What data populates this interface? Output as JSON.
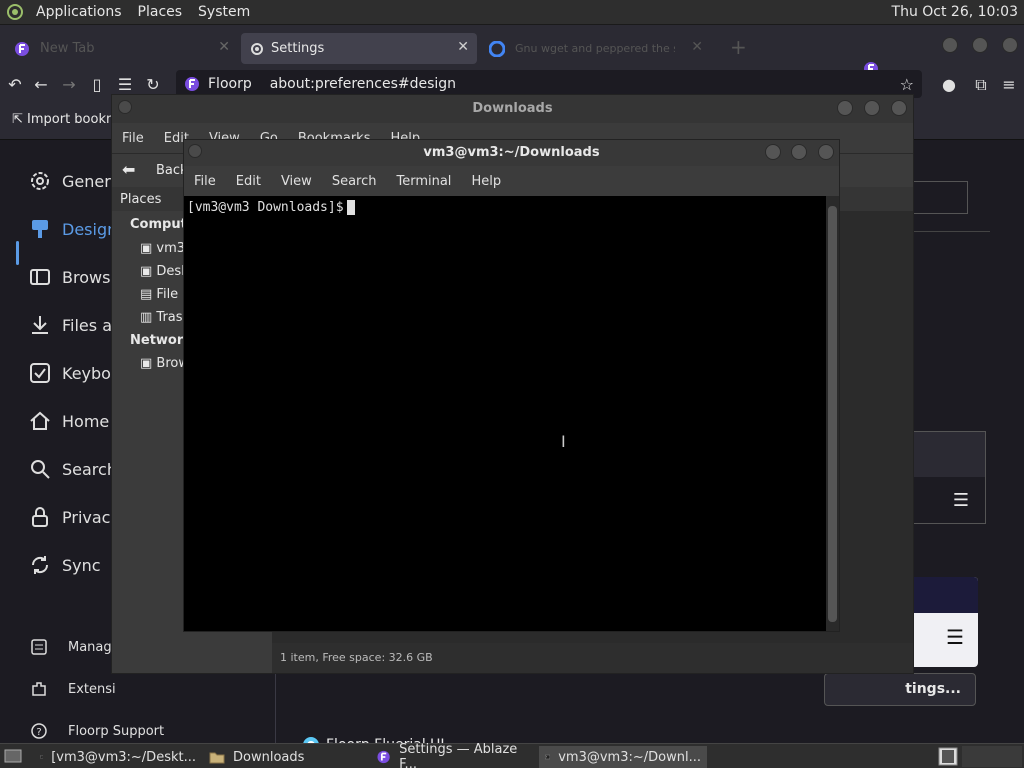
{
  "top_panel": {
    "menus": [
      "Applications",
      "Places",
      "System"
    ],
    "clock": "Thu Oct 26, 10:03"
  },
  "browser": {
    "tabs": [
      {
        "label": "New Tab",
        "active": false
      },
      {
        "label": "Settings",
        "active": true
      },
      {
        "label": "Gnu wget and peppered the same",
        "active": false
      }
    ],
    "toolbar": {
      "identity": "Floorp",
      "url": "about:preferences#design"
    },
    "bookmarks": {
      "import_label": "Import bookm"
    }
  },
  "settings": {
    "sidebar": [
      {
        "label": "General",
        "icon": "gear-icon"
      },
      {
        "label": "Design",
        "icon": "brush-icon",
        "selected": true
      },
      {
        "label": "Browser",
        "icon": "browser-icon"
      },
      {
        "label": "Files and",
        "icon": "download-icon"
      },
      {
        "label": "Keyboard",
        "icon": "keyboard-icon"
      },
      {
        "label": "Home",
        "icon": "home-icon"
      },
      {
        "label": "Search",
        "icon": "search-icon"
      },
      {
        "label": "Privacy",
        "icon": "lock-icon"
      },
      {
        "label": "Sync",
        "icon": "sync-icon"
      }
    ],
    "sidebar_small": [
      {
        "label": "Manage",
        "icon": "manage-icon"
      },
      {
        "label": "Extensi",
        "icon": "extension-icon"
      },
      {
        "label": "Floorp Support",
        "icon": "help-icon"
      }
    ],
    "settings_button": "tings...",
    "radio_option": "Floorp Fluerial UI"
  },
  "file_manager": {
    "title": "Downloads",
    "menus": [
      "File",
      "Edit",
      "View",
      "Go",
      "Bookmarks",
      "Help"
    ],
    "back_label": "Back",
    "places_header": "Places",
    "computer_header": "Computer",
    "computer_items": [
      "vm3",
      "Desktop",
      "File System",
      "Trash"
    ],
    "network_header": "Network",
    "network_items": [
      "Browse Network"
    ],
    "status": "1 item, Free space: 32.6 GB"
  },
  "terminal": {
    "title": "vm3@vm3:~/Downloads",
    "menus": [
      "File",
      "Edit",
      "View",
      "Search",
      "Terminal",
      "Help"
    ],
    "prompt": "[vm3@vm3 Downloads]$"
  },
  "taskbar": {
    "items": [
      {
        "label": "[vm3@vm3:~/Deskt...",
        "icon": "terminal-icon"
      },
      {
        "label": "Downloads",
        "icon": "folder-icon"
      },
      {
        "label": "Settings — Ablaze F...",
        "icon": "floorp-icon"
      },
      {
        "label": "vm3@vm3:~/Downl...",
        "icon": "terminal-icon",
        "active": true
      }
    ]
  },
  "colors": {
    "accent": "#5b9be6",
    "floorp": "#7a4de0"
  }
}
